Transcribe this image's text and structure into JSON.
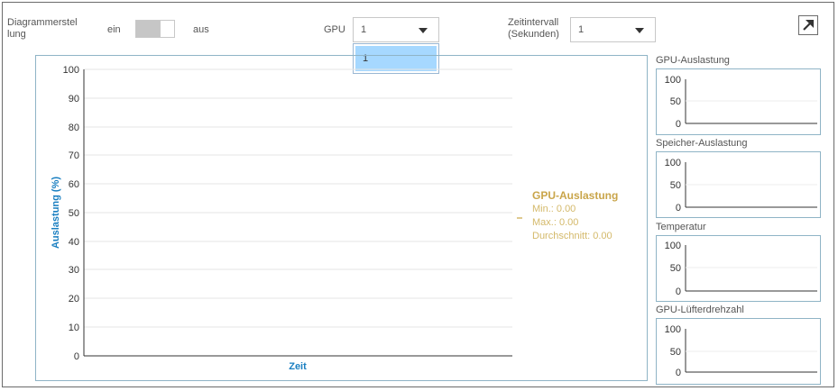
{
  "controls": {
    "chart_setting_label_1": "Diagrammerstel",
    "chart_setting_label_2": "lung",
    "toggle_on_label": "ein",
    "toggle_off_label": "aus",
    "gpu_label": "GPU",
    "gpu_value": "1",
    "gpu_options": [
      "1"
    ],
    "interval_label_1": "Zeitintervall",
    "interval_label_2": "(Sekunden)",
    "interval_value": "1"
  },
  "main_chart": {
    "y_axis_label": "Auslastung (%)",
    "x_axis_label": "Zeit",
    "y_ticks": [
      "100",
      "90",
      "80",
      "70",
      "60",
      "50",
      "40",
      "30",
      "20",
      "10",
      "0"
    ],
    "legend": {
      "title": "GPU-Auslastung",
      "min": "Min.: 0.00",
      "max": "Max.: 0.00",
      "avg": "Durchschnitt: 0.00"
    }
  },
  "mini_charts": [
    {
      "title": "GPU-Auslastung",
      "ticks": [
        "100",
        "50",
        "0"
      ]
    },
    {
      "title": "Speicher-Auslastung",
      "ticks": [
        "100",
        "50",
        "0"
      ]
    },
    {
      "title": "Temperatur",
      "ticks": [
        "100",
        "50",
        "0"
      ]
    },
    {
      "title": "GPU-Lüfterdrehzahl",
      "ticks": [
        "100",
        "50",
        "0"
      ]
    }
  ],
  "colors": {
    "axis_label": "#1a7fc1",
    "legend": "#c9a54a",
    "dropdown_highlight": "#a6d8ff"
  },
  "icons": {
    "expand": "arrow-up-right-icon"
  }
}
